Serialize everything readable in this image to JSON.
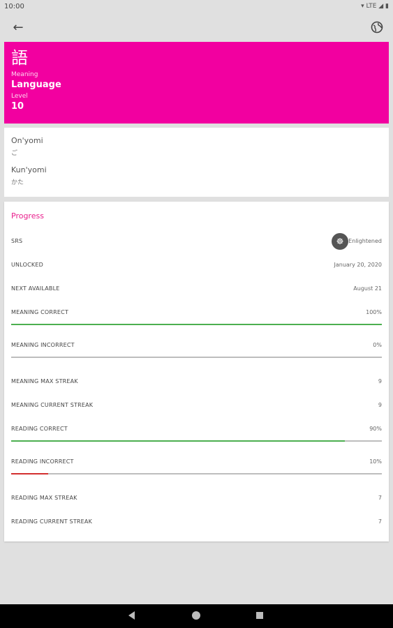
{
  "statusbar": {
    "time": "10:00",
    "icons": "▾ LTE ◢ ▮"
  },
  "appbar": {
    "back_icon": "arrow-left-icon",
    "globe_icon": "globe-icon"
  },
  "header": {
    "kanji": "語",
    "meaning_label": "Meaning",
    "meaning": "Language",
    "level_label": "Level",
    "level": "10"
  },
  "readings": {
    "onyomi_label": "On'yomi",
    "onyomi": "ご",
    "kunyomi_label": "Kun'yomi",
    "kunyomi": "かた"
  },
  "progress": {
    "title": "Progress",
    "colors": {
      "good": "#4caf50",
      "bad": "#d32f2f",
      "track": "#bdbdbd",
      "accent": "#e91e8c"
    },
    "srs": {
      "label": "SRS",
      "value": "Enlightened",
      "icon": "enlightened-icon"
    },
    "unlocked": {
      "label": "UNLOCKED",
      "value": "January 20, 2020"
    },
    "next_available": {
      "label": "NEXT AVAILABLE",
      "value": "August 21"
    },
    "meaning_correct": {
      "label": "MEANING CORRECT",
      "value": "100%",
      "fraction": 1.0
    },
    "meaning_incorrect": {
      "label": "MEANING INCORRECT",
      "value": "0%",
      "fraction": 0.0
    },
    "meaning_max_streak": {
      "label": "MEANING MAX STREAK",
      "value": "9"
    },
    "meaning_current_streak": {
      "label": "MEANING CURRENT STREAK",
      "value": "9"
    },
    "reading_correct": {
      "label": "READING CORRECT",
      "value": "90%",
      "fraction": 0.9
    },
    "reading_incorrect": {
      "label": "READING INCORRECT",
      "value": "10%",
      "fraction": 0.1
    },
    "reading_max_streak": {
      "label": "READING MAX STREAK",
      "value": "7"
    },
    "reading_current_streak": {
      "label": "READING CURRENT STREAK",
      "value": "7"
    }
  },
  "navbar": {
    "back": "nav-back-icon",
    "home": "nav-home-icon",
    "recent": "nav-recent-icon"
  }
}
